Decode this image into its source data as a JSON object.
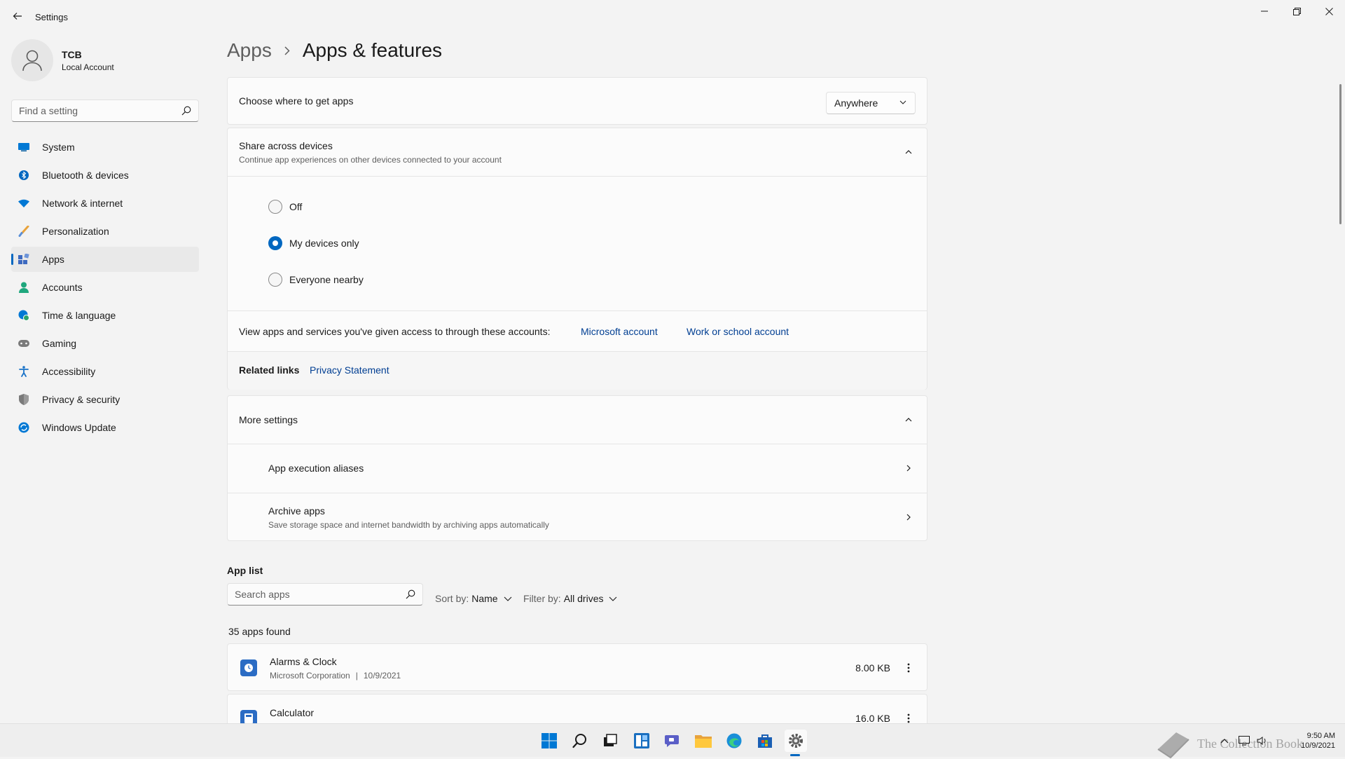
{
  "window": {
    "title": "Settings"
  },
  "profile": {
    "name": "TCB",
    "account_type": "Local Account"
  },
  "sidebar": {
    "search_placeholder": "Find a setting",
    "items": [
      {
        "label": "System",
        "icon": "system-icon",
        "color": "#0078d4"
      },
      {
        "label": "Bluetooth & devices",
        "icon": "bluetooth-icon",
        "color": "#0067c0"
      },
      {
        "label": "Network & internet",
        "icon": "wifi-icon",
        "color": "#0078d4"
      },
      {
        "label": "Personalization",
        "icon": "brush-icon",
        "color": "#e8a33c"
      },
      {
        "label": "Apps",
        "icon": "apps-icon",
        "color": "#3d6ac0",
        "active": true
      },
      {
        "label": "Accounts",
        "icon": "person-icon",
        "color": "#1fa77d"
      },
      {
        "label": "Time & language",
        "icon": "globe-clock-icon",
        "color": "#0078d4"
      },
      {
        "label": "Gaming",
        "icon": "gamepad-icon",
        "color": "#6b6b6b"
      },
      {
        "label": "Accessibility",
        "icon": "accessibility-icon",
        "color": "#1a73c8"
      },
      {
        "label": "Privacy & security",
        "icon": "shield-icon",
        "color": "#6b6b6b"
      },
      {
        "label": "Windows Update",
        "icon": "update-icon",
        "color": "#0078d4"
      }
    ]
  },
  "breadcrumb": {
    "parent": "Apps",
    "current": "Apps & features"
  },
  "get_apps": {
    "label": "Choose where to get apps",
    "value": "Anywhere"
  },
  "share": {
    "title": "Share across devices",
    "subtitle": "Continue app experiences on other devices connected to your account",
    "options": [
      {
        "label": "Off",
        "checked": false
      },
      {
        "label": "My devices only",
        "checked": true
      },
      {
        "label": "Everyone nearby",
        "checked": false
      }
    ],
    "accounts_text": "View apps and services you've given access to through these accounts:",
    "microsoft_link": "Microsoft account",
    "work_link": "Work or school account"
  },
  "related": {
    "label": "Related links",
    "privacy_link": "Privacy Statement"
  },
  "more_settings": {
    "title": "More settings",
    "aliases": "App execution aliases",
    "archive_title": "Archive apps",
    "archive_sub": "Save storage space and internet bandwidth by archiving apps automatically"
  },
  "app_list": {
    "title": "App list",
    "search_placeholder": "Search apps",
    "sort_label": "Sort by:",
    "sort_value": "Name",
    "filter_label": "Filter by:",
    "filter_value": "All drives",
    "count": "35 apps found",
    "apps": [
      {
        "name": "Alarms & Clock",
        "publisher": "Microsoft Corporation",
        "date": "10/9/2021",
        "size": "8.00 KB",
        "icon": "alarm-clock-icon"
      },
      {
        "name": "Calculator",
        "publisher": "",
        "date": "",
        "size": "16.0 KB",
        "icon": "calculator-icon"
      }
    ]
  },
  "taskbar": {
    "time": "9:50 AM",
    "date": "10/9/2021",
    "watermark": "The Collection Book"
  },
  "colors": {
    "accent": "#0067c0",
    "link": "#003e92"
  }
}
